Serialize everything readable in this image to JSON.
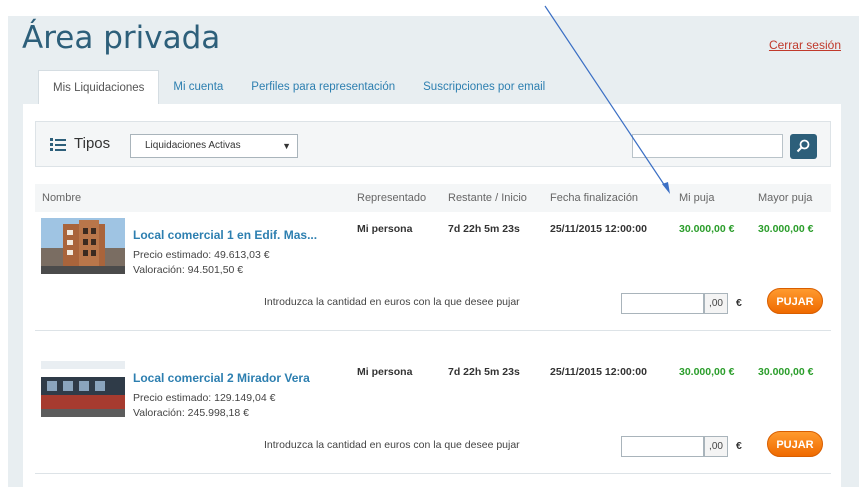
{
  "page": {
    "title": "Área privada",
    "logout_label": "Cerrar sesión"
  },
  "tabs": [
    {
      "label": "Mis Liquidaciones",
      "active": true
    },
    {
      "label": "Mi cuenta",
      "active": false
    },
    {
      "label": "Perfiles para representación",
      "active": false
    },
    {
      "label": "Suscripciones por email",
      "active": false
    }
  ],
  "filter": {
    "label": "Tipos",
    "select_value": "Liquidaciones Activas",
    "search_value": ""
  },
  "table": {
    "headers": {
      "name": "Nombre",
      "represented": "Representado",
      "remaining": "Restante / Inicio",
      "end_date": "Fecha finalización",
      "my_bid": "Mi puja",
      "top_bid": "Mayor puja"
    },
    "rows": [
      {
        "title": "Local comercial 1 en Edif. Mas...",
        "estimated_price": "Precio estimado: 49.613,03 €",
        "valuation": "Valoración: 94.501,50 €",
        "represented": "Mi persona",
        "remaining": "7d 22h 5m 23s",
        "end_date": "25/11/2015 12:00:00",
        "my_bid": "30.000,00 €",
        "top_bid": "30.000,00 €",
        "bid_prompt": "Introduzca la cantidad en euros con la que desee pujar",
        "bid_value": "",
        "cents": ",00",
        "currency": "€",
        "bid_button": "PUJAR"
      },
      {
        "title": "Local comercial 2 Mirador Vera",
        "estimated_price": "Precio estimado: 129.149,04 €",
        "valuation": "Valoración: 245.998,18 €",
        "represented": "Mi persona",
        "remaining": "7d 22h 5m 23s",
        "end_date": "25/11/2015 12:00:00",
        "my_bid": "30.000,00 €",
        "top_bid": "30.000,00 €",
        "bid_prompt": "Introduzca la cantidad en euros con la que desee pujar",
        "bid_value": "",
        "cents": ",00",
        "currency": "€",
        "bid_button": "PUJAR"
      }
    ]
  },
  "colors": {
    "accent": "#2d5f7a",
    "link": "#2d7fb0",
    "bid_green": "#2a9d2a",
    "button_orange": "#f07a10",
    "logout_red": "#c0392b",
    "annotation_arrow": "#3b6fc4"
  },
  "icons": {
    "filter": "list-icon",
    "search": "search-icon"
  }
}
